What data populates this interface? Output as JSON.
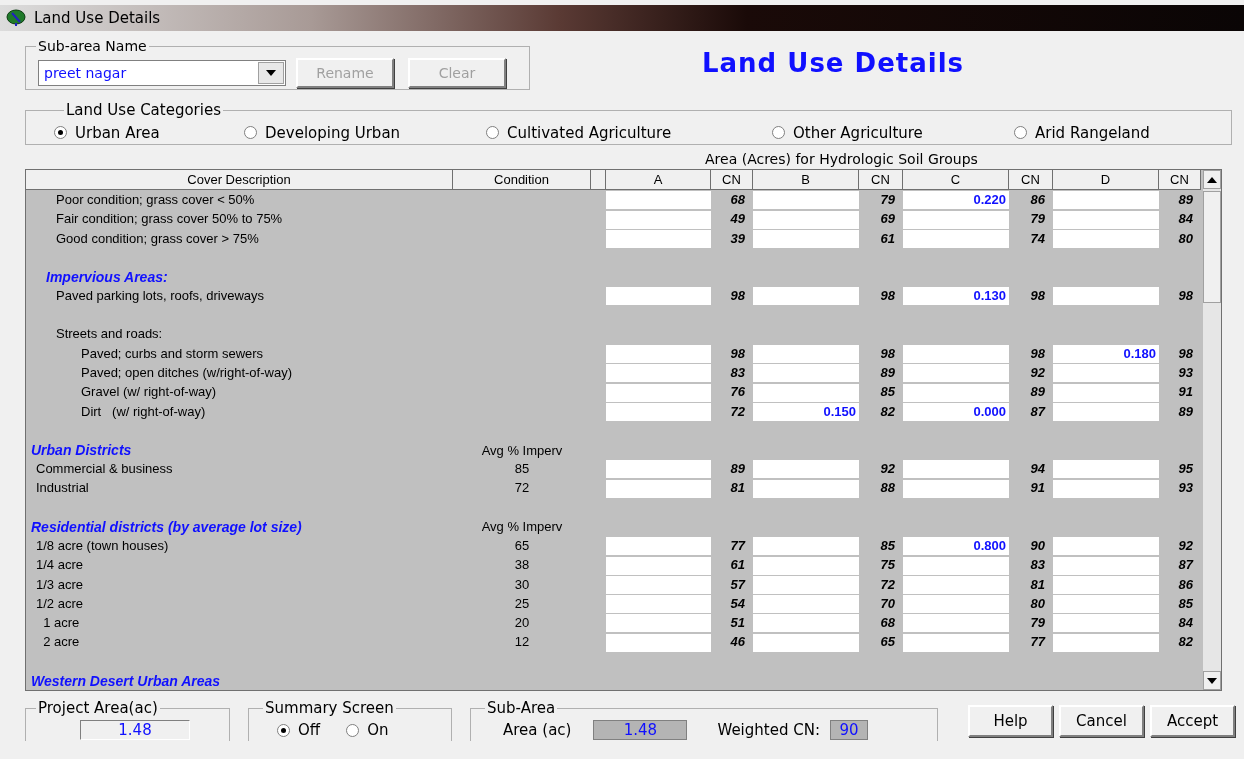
{
  "window": {
    "title": "Land Use Details"
  },
  "sub_area": {
    "legend": "Sub-area Name",
    "value": "preet nagar",
    "buttons": [
      {
        "label": "Rename",
        "disabled": true
      },
      {
        "label": "Clear",
        "disabled": true
      }
    ]
  },
  "heading": "Land Use Details",
  "categories": {
    "legend": "Land Use Categories",
    "options": [
      {
        "label": "Urban Area",
        "selected": true
      },
      {
        "label": "Developing Urban",
        "selected": false
      },
      {
        "label": "Cultivated Agriculture",
        "selected": false
      },
      {
        "label": "Other Agriculture",
        "selected": false
      },
      {
        "label": "Arid Rangeland",
        "selected": false
      }
    ]
  },
  "table": {
    "caption": "Area (Acres) for Hydrologic Soil Groups",
    "columns": [
      "Cover Description",
      "Condition",
      "A",
      "CN",
      "B",
      "CN",
      "C",
      "CN",
      "D",
      "CN"
    ],
    "rows": [
      {
        "kind": "item",
        "description": "Poor condition; grass cover < 50%",
        "soil": [
          {
            "cn": "68"
          },
          {
            "cn": "79"
          },
          {
            "area": "0.220",
            "cn": "86"
          },
          {
            "cn": "89"
          }
        ]
      },
      {
        "kind": "item",
        "description": "Fair condition; grass cover 50% to 75%",
        "soil": [
          {
            "cn": "49"
          },
          {
            "cn": "69"
          },
          {
            "cn": "79"
          },
          {
            "cn": "84"
          }
        ]
      },
      {
        "kind": "item",
        "description": "Good condition; grass cover > 75%",
        "soil": [
          {
            "cn": "39"
          },
          {
            "cn": "61"
          },
          {
            "cn": "74"
          },
          {
            "cn": "80"
          }
        ]
      },
      {
        "kind": "subheading",
        "description": "Impervious Areas:"
      },
      {
        "kind": "item",
        "description": "Paved parking lots, roofs, driveways",
        "soil": [
          {
            "cn": "98"
          },
          {
            "cn": "98"
          },
          {
            "area": "0.130",
            "cn": "98"
          },
          {
            "cn": "98"
          }
        ]
      },
      {
        "kind": "label",
        "description": "Streets and roads:"
      },
      {
        "kind": "subitem",
        "description": "Paved; curbs and storm sewers",
        "soil": [
          {
            "cn": "98"
          },
          {
            "cn": "98"
          },
          {
            "cn": "98"
          },
          {
            "area": "0.180",
            "cn": "98"
          }
        ]
      },
      {
        "kind": "subitem",
        "description": "Paved; open ditches (w/right-of-way)",
        "soil": [
          {
            "cn": "83"
          },
          {
            "cn": "89"
          },
          {
            "cn": "92"
          },
          {
            "cn": "93"
          }
        ]
      },
      {
        "kind": "subitem",
        "description": "Gravel (w/ right-of-way)",
        "soil": [
          {
            "cn": "76"
          },
          {
            "cn": "85"
          },
          {
            "cn": "89"
          },
          {
            "cn": "91"
          }
        ]
      },
      {
        "kind": "subitem",
        "description": "Dirt   (w/ right-of-way)",
        "soil": [
          {
            "cn": "72"
          },
          {
            "area": "0.150",
            "cn": "82"
          },
          {
            "area": "0.000",
            "cn": "87"
          },
          {
            "cn": "89"
          }
        ]
      },
      {
        "kind": "heading",
        "description": "Urban Districts",
        "condition": "Avg % Imperv"
      },
      {
        "kind": "district",
        "description": "Commercial & business",
        "condition": "85",
        "soil": [
          {
            "cn": "89"
          },
          {
            "cn": "92"
          },
          {
            "cn": "94"
          },
          {
            "cn": "95"
          }
        ]
      },
      {
        "kind": "district",
        "description": "Industrial",
        "condition": "72",
        "soil": [
          {
            "cn": "81"
          },
          {
            "cn": "88"
          },
          {
            "cn": "91"
          },
          {
            "cn": "93"
          }
        ]
      },
      {
        "kind": "heading",
        "description": "Residential districts (by average lot size)",
        "condition": "Avg % Imperv"
      },
      {
        "kind": "district",
        "description": "1/8 acre (town houses)",
        "condition": "65",
        "soil": [
          {
            "cn": "77"
          },
          {
            "cn": "85"
          },
          {
            "area": "0.800",
            "cn": "90"
          },
          {
            "cn": "92"
          }
        ]
      },
      {
        "kind": "district",
        "description": "1/4 acre",
        "condition": "38",
        "soil": [
          {
            "cn": "61"
          },
          {
            "cn": "75"
          },
          {
            "cn": "83"
          },
          {
            "cn": "87"
          }
        ]
      },
      {
        "kind": "district",
        "description": "1/3 acre",
        "condition": "30",
        "soil": [
          {
            "cn": "57"
          },
          {
            "cn": "72"
          },
          {
            "cn": "81"
          },
          {
            "cn": "86"
          }
        ]
      },
      {
        "kind": "district",
        "description": "1/2 acre",
        "condition": "25",
        "soil": [
          {
            "cn": "54"
          },
          {
            "cn": "70"
          },
          {
            "cn": "80"
          },
          {
            "cn": "85"
          }
        ]
      },
      {
        "kind": "district",
        "description": "  1 acre",
        "condition": "20",
        "soil": [
          {
            "cn": "51"
          },
          {
            "cn": "68"
          },
          {
            "cn": "79"
          },
          {
            "cn": "84"
          }
        ]
      },
      {
        "kind": "district",
        "description": "  2 acre",
        "condition": "12",
        "soil": [
          {
            "cn": "46"
          },
          {
            "cn": "65"
          },
          {
            "cn": "77"
          },
          {
            "cn": "82"
          }
        ]
      },
      {
        "kind": "heading",
        "description": "Western Desert Urban Areas"
      }
    ]
  },
  "project_area": {
    "legend": "Project Area(ac)",
    "value": "1.48"
  },
  "summary_screen": {
    "legend": "Summary Screen",
    "options": [
      {
        "label": "Off",
        "selected": true
      },
      {
        "label": "On",
        "selected": false
      }
    ]
  },
  "sub_area_totals": {
    "legend": "Sub-Area",
    "area_label": "Area (ac)",
    "area_value": "1.48",
    "cn_label": "Weighted CN:",
    "cn_value": "90"
  },
  "buttons": [
    {
      "label": "Help"
    },
    {
      "label": "Cancel"
    },
    {
      "label": "Accept"
    }
  ]
}
